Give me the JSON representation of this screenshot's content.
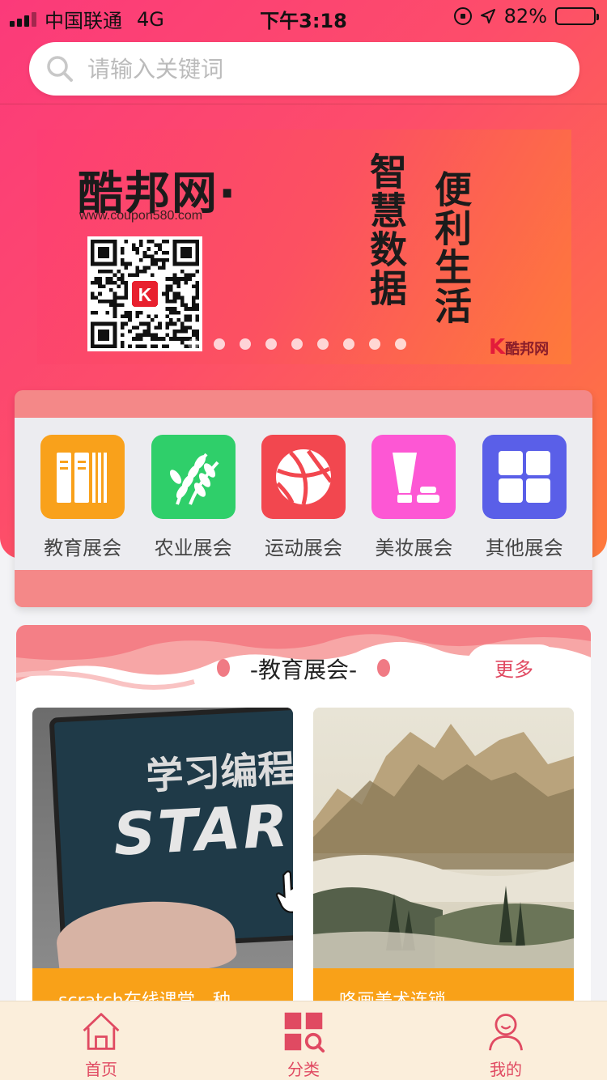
{
  "status_bar": {
    "carrier": "中国联通",
    "network": "4G",
    "time": "下午3:18",
    "battery_percent": "82%",
    "battery_level": 0.82
  },
  "search": {
    "placeholder": "请输入关键词",
    "icon": "search-icon"
  },
  "banner": {
    "brand": "酷邦网·",
    "url": "www.coupon580.com",
    "slogan_1": "智慧数据",
    "slogan_2": "便利生活",
    "corner_logo_mark": "K",
    "corner_logo_text": "酷邦网",
    "slide_count": 9,
    "active_slide": 0
  },
  "categories": [
    {
      "label": "教育展会",
      "icon": "books-icon",
      "color": "#f9a11b"
    },
    {
      "label": "农业展会",
      "icon": "wheat-icon",
      "color": "#2fcf6a"
    },
    {
      "label": "运动展会",
      "icon": "basketball-icon",
      "color": "#f2474f"
    },
    {
      "label": "美妆展会",
      "icon": "cosmetics-icon",
      "color": "#fd57d4"
    },
    {
      "label": "其他展会",
      "icon": "grid-icon",
      "color": "#5a5fe8"
    }
  ],
  "section": {
    "title": "-教育展会-",
    "more_label": "更多",
    "cards": [
      {
        "screen_text_1": "学习编程",
        "screen_text_2": "STAR",
        "caption": "scratch在线课堂，种"
      },
      {
        "caption": "咚画美术连锁"
      }
    ]
  },
  "tab_bar": {
    "tabs": [
      {
        "label": "首页",
        "icon": "home-icon"
      },
      {
        "label": "分类",
        "icon": "category-search-icon"
      },
      {
        "label": "我的",
        "icon": "user-icon"
      }
    ]
  },
  "colors": {
    "accent": "#e04a62",
    "hero_start": "#fb3a7a",
    "hero_end": "#fe7a3c",
    "tab_bar_bg": "#fbeedb",
    "caption_bg": "#f9a118"
  }
}
